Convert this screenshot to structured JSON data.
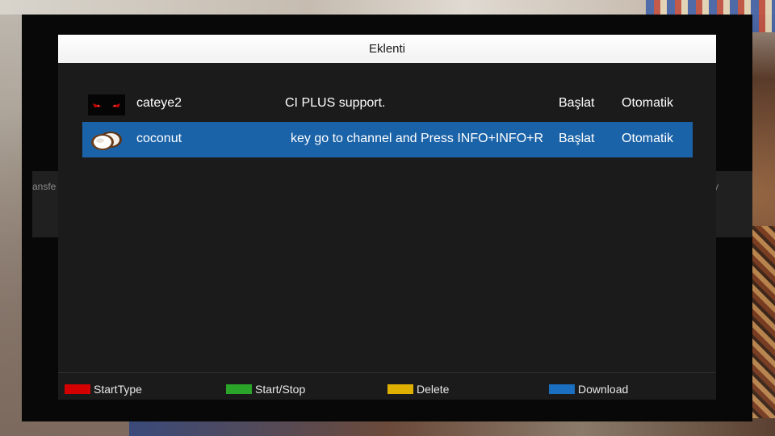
{
  "window": {
    "title": "Eklenti"
  },
  "background": {
    "left_text": "ansfe",
    "right_text": "y"
  },
  "plugins": [
    {
      "icon": "cateye-icon",
      "name": "cateye2",
      "description": "CI PLUS support.",
      "status": "Başlat",
      "mode": "Otomatik",
      "selected": false
    },
    {
      "icon": "coconut-icon",
      "name": "coconut",
      "description": "key go to channel and Press INFO+INFO+R",
      "status": "Başlat",
      "mode": "Otomatik",
      "selected": true
    }
  ],
  "footer": {
    "red": {
      "label": "StartType",
      "color": "#d40000"
    },
    "green": {
      "label": "Start/Stop",
      "color": "#2aa52a"
    },
    "yellow": {
      "label": "Delete",
      "color": "#e0b000"
    },
    "blue": {
      "label": "Download",
      "color": "#1a6fc0"
    }
  },
  "colors": {
    "selection": "#1b63a8",
    "panel": "#1b1b1b"
  }
}
